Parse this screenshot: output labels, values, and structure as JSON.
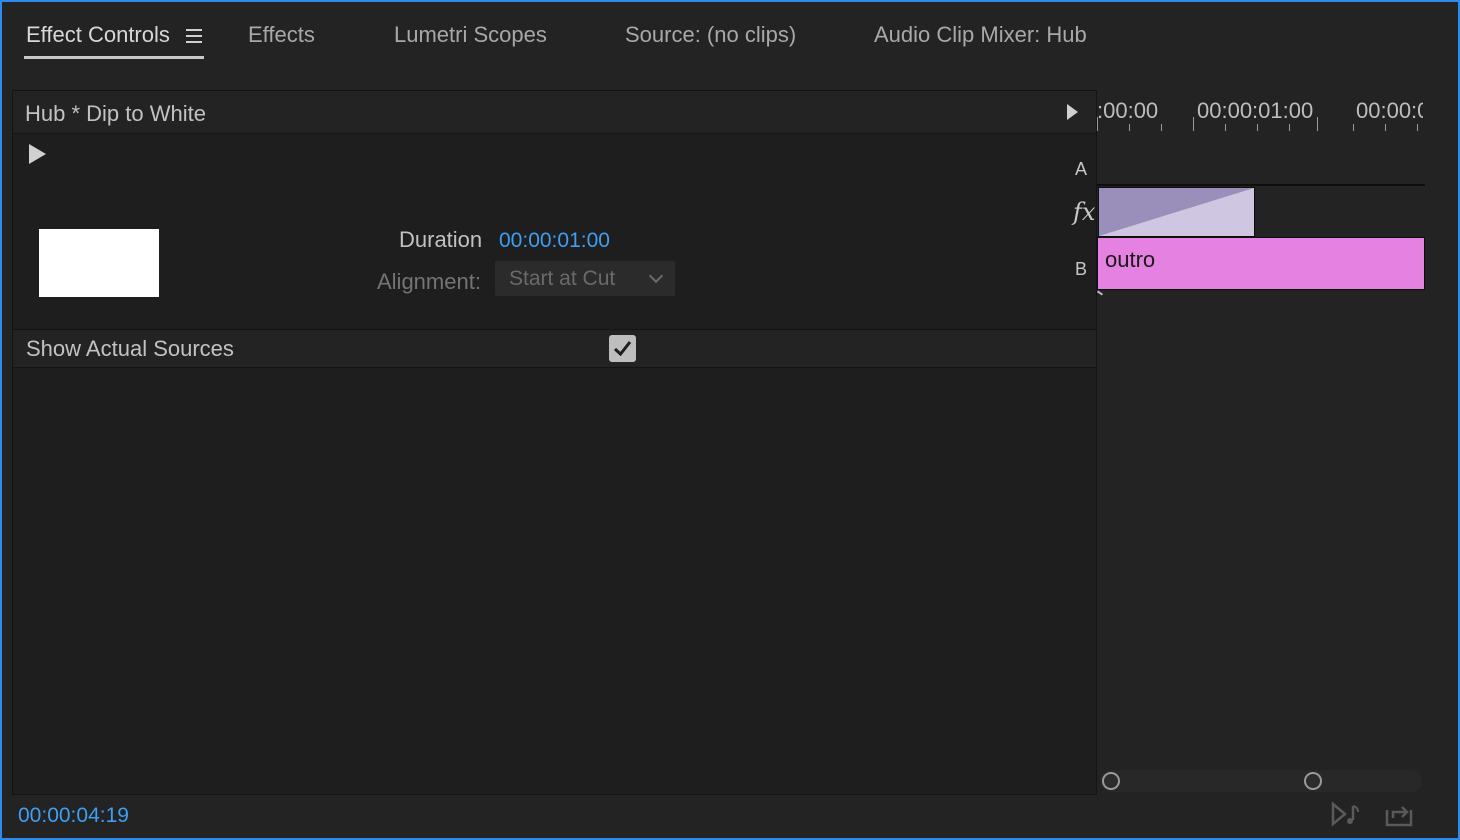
{
  "tabs": [
    {
      "label": "Effect Controls",
      "active": true
    },
    {
      "label": "Effects"
    },
    {
      "label": "Lumetri Scopes"
    },
    {
      "label": "Source: (no clips)"
    },
    {
      "label": "Audio Clip Mixer: Hub"
    }
  ],
  "effect": {
    "title": "Hub * Dip to White",
    "duration_label": "Duration",
    "duration_value": "00:00:01:00",
    "alignment_label": "Alignment:",
    "alignment_value": "Start at Cut",
    "show_sources_label": "Show Actual Sources",
    "show_sources_checked": true
  },
  "timeline": {
    "ruler": [
      ":00:00",
      "00:00:01:00",
      "00:00:0"
    ],
    "track_a_label": "A",
    "fx_label": "fx",
    "track_b_label": "B",
    "clip_b_label": "outro",
    "clip_b_color": "#e582e1",
    "transition_colors": [
      "#9a8fba",
      "#cfc7e1"
    ]
  },
  "footer": {
    "timecode": "00:00:04:19"
  },
  "icons": {
    "panel_menu": "hamburger-menu-icon",
    "expand": "triangle-right-icon",
    "play": "play-icon",
    "audio": "audio-note-icon",
    "export": "export-frame-icon"
  }
}
